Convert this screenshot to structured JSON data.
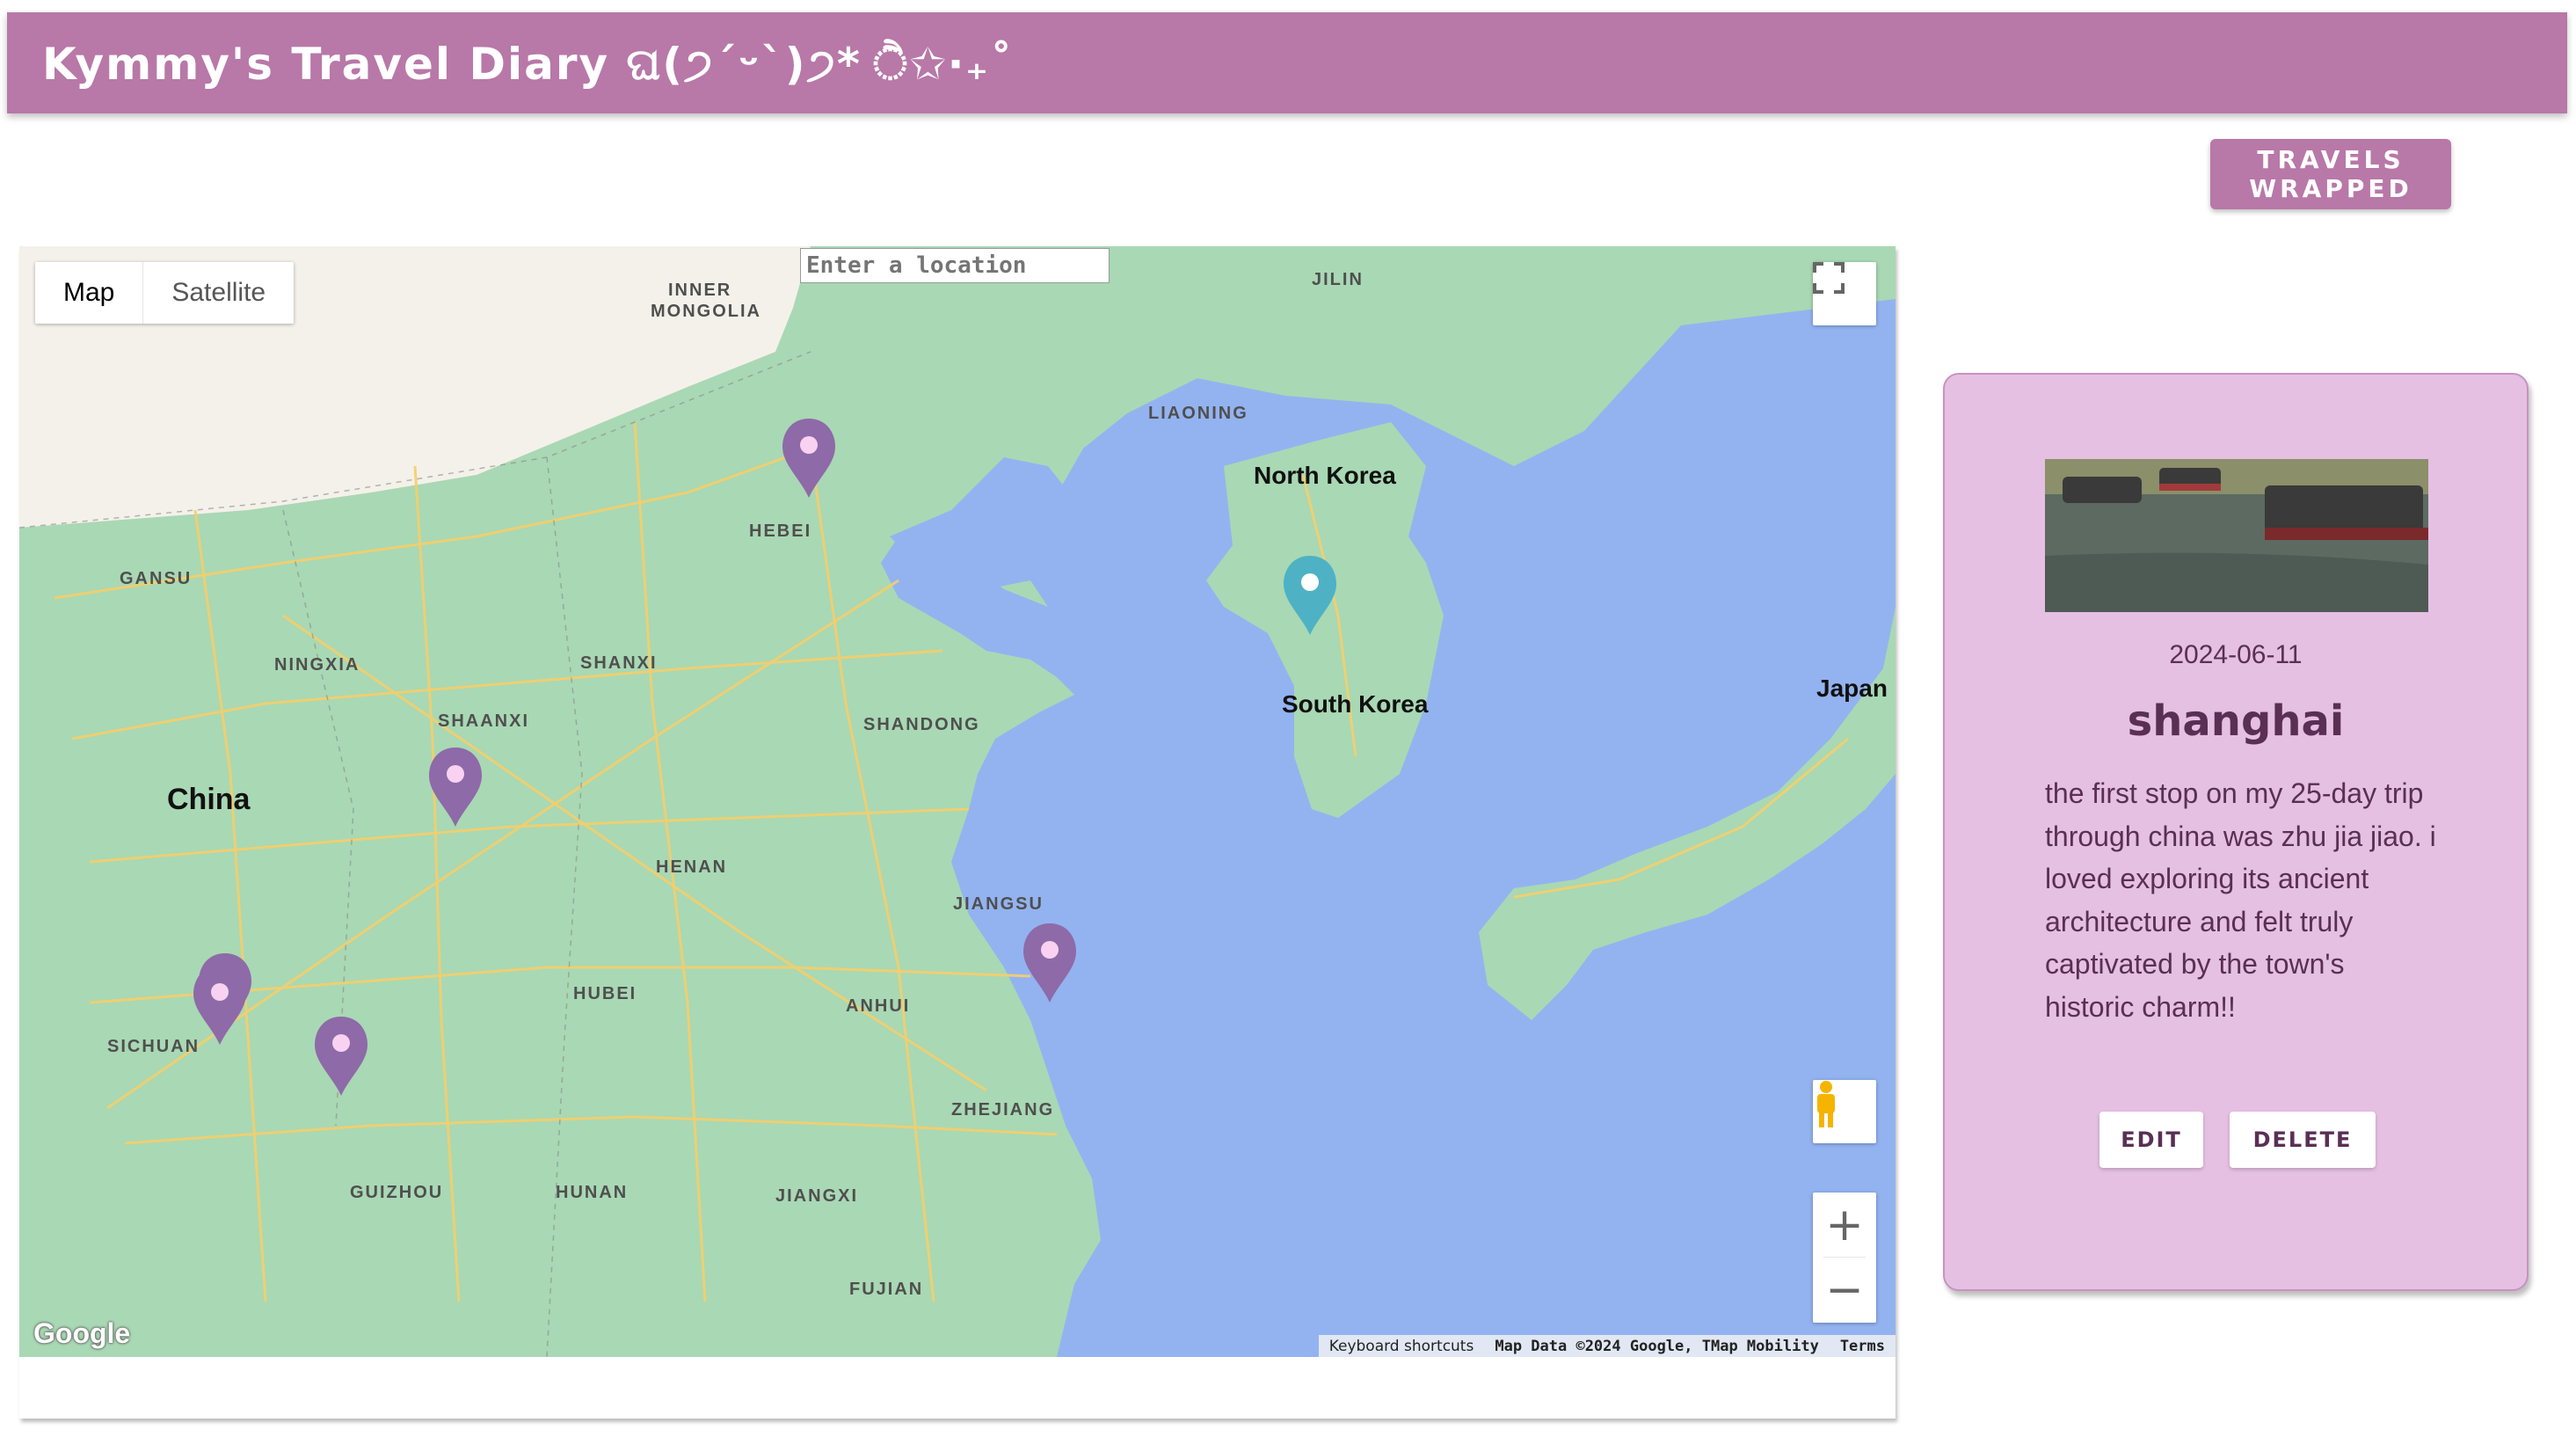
{
  "header": {
    "title": "Kymmy's Travel Diary ଘ(੭ˊᵕˋ)੭* ੈ✩‧₊˚"
  },
  "wrapped_button": "TRAVELS WRAPPED",
  "map": {
    "type_controls": [
      "Map",
      "Satellite"
    ],
    "search_placeholder": "Enter a location",
    "labels": {
      "inner_mongolia_1": "INNER",
      "inner_mongolia_2": "MONGOLIA",
      "jilin": "JILIN",
      "liaoning": "LIAONING",
      "north_korea": "North Korea",
      "hebei": "HEBEI",
      "gansu": "GANSU",
      "ningxia": "NINGXIA",
      "shanxi": "SHANXI",
      "shaanxi": "SHAANXI",
      "shandong": "SHANDONG",
      "south_korea": "South Korea",
      "japan": "Japan",
      "china": "China",
      "henan": "HENAN",
      "jiangsu": "JIANGSU",
      "hubei": "HUBEI",
      "anhui": "ANHUI",
      "sichuan": "SICHUAN",
      "zhejiang": "ZHEJIANG",
      "guizhou": "GUIZHOU",
      "hunan": "HUNAN",
      "jiangxi": "JIANGXI",
      "fujian": "FUJIAN"
    },
    "google_logo": "Google",
    "attribution": {
      "shortcuts": "Keyboard shortcuts",
      "data": "Map Data ©2024 Google, TMap Mobility",
      "terms": "Terms"
    },
    "colors": {
      "water": "#93b3f0",
      "land": "#a9d8b4",
      "north_land": "#f4f1ea",
      "roads": "#f6cf6a",
      "pin_default": "#8e6aa8",
      "pin_selected": "#4eb2c4"
    },
    "icons": [
      "fullscreen-icon",
      "pegman-icon",
      "zoom-in-icon",
      "zoom-out-icon",
      "map-pin-icon"
    ]
  },
  "entry": {
    "date": "2024-06-11",
    "title": "shanghai",
    "description": "the first stop on my 25-day trip through china was zhu jia jiao. i loved exploring its ancient architecture and felt truly captivated by the town's historic charm!!",
    "edit_label": "EDIT",
    "delete_label": "DELETE"
  }
}
